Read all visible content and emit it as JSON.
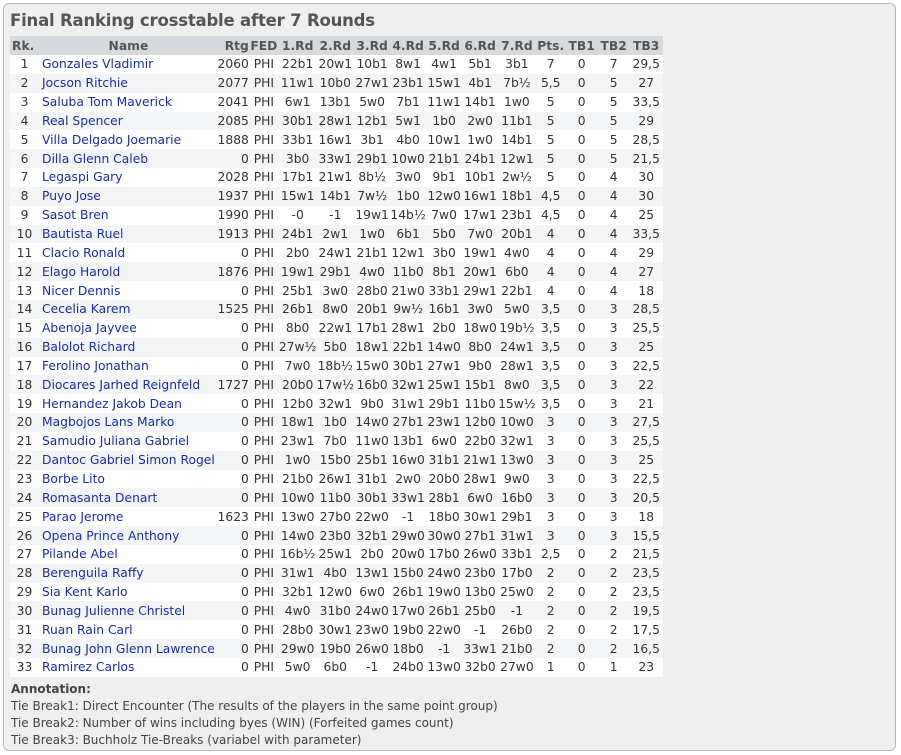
{
  "title": "Final Ranking crosstable after 7 Rounds",
  "columns": [
    "Rk.",
    "Name",
    "Rtg",
    "FED",
    "1.Rd",
    "2.Rd",
    "3.Rd",
    "4.Rd",
    "5.Rd",
    "6.Rd",
    "7.Rd",
    "Pts.",
    "TB1",
    "TB2",
    "TB3"
  ],
  "rows": [
    [
      "1",
      "Gonzales Vladimir",
      "2060",
      "PHI",
      "22b1",
      "20w1",
      "10b1",
      "8w1",
      "4w1",
      "5b1",
      "3b1",
      "7",
      "0",
      "7",
      "29,5"
    ],
    [
      "2",
      "Jocson Ritchie",
      "2077",
      "PHI",
      "11w1",
      "10b0",
      "27w1",
      "23b1",
      "15w1",
      "4b1",
      "7b½",
      "5,5",
      "0",
      "5",
      "27"
    ],
    [
      "3",
      "Saluba Tom Maverick",
      "2041",
      "PHI",
      "6w1",
      "13b1",
      "5w0",
      "7b1",
      "11w1",
      "14b1",
      "1w0",
      "5",
      "0",
      "5",
      "33,5"
    ],
    [
      "4",
      "Real Spencer",
      "2085",
      "PHI",
      "30b1",
      "28w1",
      "12b1",
      "5w1",
      "1b0",
      "2w0",
      "11b1",
      "5",
      "0",
      "5",
      "29"
    ],
    [
      "5",
      "Villa Delgado Joemarie",
      "1888",
      "PHI",
      "33b1",
      "16w1",
      "3b1",
      "4b0",
      "10w1",
      "1w0",
      "14b1",
      "5",
      "0",
      "5",
      "28,5"
    ],
    [
      "6",
      "Dilla Glenn Caleb",
      "0",
      "PHI",
      "3b0",
      "33w1",
      "29b1",
      "10w0",
      "21b1",
      "24b1",
      "12w1",
      "5",
      "0",
      "5",
      "21,5"
    ],
    [
      "7",
      "Legaspi Gary",
      "2028",
      "PHI",
      "17b1",
      "21w1",
      "8b½",
      "3w0",
      "9b1",
      "10b1",
      "2w½",
      "5",
      "0",
      "4",
      "30"
    ],
    [
      "8",
      "Puyo Jose",
      "1937",
      "PHI",
      "15w1",
      "14b1",
      "7w½",
      "1b0",
      "12w0",
      "16w1",
      "18b1",
      "4,5",
      "0",
      "4",
      "30"
    ],
    [
      "9",
      "Sasot Bren",
      "1990",
      "PHI",
      "-0",
      "-1",
      "19w1",
      "14b½",
      "7w0",
      "17w1",
      "23b1",
      "4,5",
      "0",
      "4",
      "25"
    ],
    [
      "10",
      "Bautista Ruel",
      "1913",
      "PHI",
      "24b1",
      "2w1",
      "1w0",
      "6b1",
      "5b0",
      "7w0",
      "20b1",
      "4",
      "0",
      "4",
      "33,5"
    ],
    [
      "11",
      "Clacio Ronald",
      "0",
      "PHI",
      "2b0",
      "24w1",
      "21b1",
      "12w1",
      "3b0",
      "19w1",
      "4w0",
      "4",
      "0",
      "4",
      "29"
    ],
    [
      "12",
      "Elago Harold",
      "1876",
      "PHI",
      "19w1",
      "29b1",
      "4w0",
      "11b0",
      "8b1",
      "20w1",
      "6b0",
      "4",
      "0",
      "4",
      "27"
    ],
    [
      "13",
      "Nicer Dennis",
      "0",
      "PHI",
      "25b1",
      "3w0",
      "28b0",
      "21w0",
      "33b1",
      "29w1",
      "22b1",
      "4",
      "0",
      "4",
      "18"
    ],
    [
      "14",
      "Cecelia Karem",
      "1525",
      "PHI",
      "26b1",
      "8w0",
      "20b1",
      "9w½",
      "16b1",
      "3w0",
      "5w0",
      "3,5",
      "0",
      "3",
      "28,5"
    ],
    [
      "15",
      "Abenoja Jayvee",
      "0",
      "PHI",
      "8b0",
      "22w1",
      "17b1",
      "28w1",
      "2b0",
      "18w0",
      "19b½",
      "3,5",
      "0",
      "3",
      "25,5"
    ],
    [
      "16",
      "Balolot Richard",
      "0",
      "PHI",
      "27w½",
      "5b0",
      "18w1",
      "22b1",
      "14w0",
      "8b0",
      "24w1",
      "3,5",
      "0",
      "3",
      "25"
    ],
    [
      "17",
      "Ferolino Jonathan",
      "0",
      "PHI",
      "7w0",
      "18b½",
      "15w0",
      "30b1",
      "27w1",
      "9b0",
      "28w1",
      "3,5",
      "0",
      "3",
      "22,5"
    ],
    [
      "18",
      "Diocares Jarhed Reignfeld",
      "1727",
      "PHI",
      "20b0",
      "17w½",
      "16b0",
      "32w1",
      "25w1",
      "15b1",
      "8w0",
      "3,5",
      "0",
      "3",
      "22"
    ],
    [
      "19",
      "Hernandez Jakob Dean",
      "0",
      "PHI",
      "12b0",
      "32w1",
      "9b0",
      "31w1",
      "29b1",
      "11b0",
      "15w½",
      "3,5",
      "0",
      "3",
      "21"
    ],
    [
      "20",
      "Magbojos Lans Marko",
      "0",
      "PHI",
      "18w1",
      "1b0",
      "14w0",
      "27b1",
      "23w1",
      "12b0",
      "10w0",
      "3",
      "0",
      "3",
      "27,5"
    ],
    [
      "21",
      "Samudio Juliana Gabriel",
      "0",
      "PHI",
      "23w1",
      "7b0",
      "11w0",
      "13b1",
      "6w0",
      "22b0",
      "32w1",
      "3",
      "0",
      "3",
      "25,5"
    ],
    [
      "22",
      "Dantoc Gabriel Simon Rogel",
      "0",
      "PHI",
      "1w0",
      "15b0",
      "25b1",
      "16w0",
      "31b1",
      "21w1",
      "13w0",
      "3",
      "0",
      "3",
      "25"
    ],
    [
      "23",
      "Borbe Lito",
      "0",
      "PHI",
      "21b0",
      "26w1",
      "31b1",
      "2w0",
      "20b0",
      "28w1",
      "9w0",
      "3",
      "0",
      "3",
      "22,5"
    ],
    [
      "24",
      "Romasanta Denart",
      "0",
      "PHI",
      "10w0",
      "11b0",
      "30b1",
      "33w1",
      "28b1",
      "6w0",
      "16b0",
      "3",
      "0",
      "3",
      "20,5"
    ],
    [
      "25",
      "Parao Jerome",
      "1623",
      "PHI",
      "13w0",
      "27b0",
      "22w0",
      "-1",
      "18b0",
      "30w1",
      "29b1",
      "3",
      "0",
      "3",
      "18"
    ],
    [
      "26",
      "Opena Prince Anthony",
      "0",
      "PHI",
      "14w0",
      "23b0",
      "32b1",
      "29w0",
      "30w0",
      "27b1",
      "31w1",
      "3",
      "0",
      "3",
      "15,5"
    ],
    [
      "27",
      "Pilande Abel",
      "0",
      "PHI",
      "16b½",
      "25w1",
      "2b0",
      "20w0",
      "17b0",
      "26w0",
      "33b1",
      "2,5",
      "0",
      "2",
      "21,5"
    ],
    [
      "28",
      "Berenguila Raffy",
      "0",
      "PHI",
      "31w1",
      "4b0",
      "13w1",
      "15b0",
      "24w0",
      "23b0",
      "17b0",
      "2",
      "0",
      "2",
      "23,5"
    ],
    [
      "29",
      "Sia Kent Karlo",
      "0",
      "PHI",
      "32b1",
      "12w0",
      "6w0",
      "26b1",
      "19w0",
      "13b0",
      "25w0",
      "2",
      "0",
      "2",
      "23,5"
    ],
    [
      "30",
      "Bunag Julienne Christel",
      "0",
      "PHI",
      "4w0",
      "31b0",
      "24w0",
      "17w0",
      "26b1",
      "25b0",
      "-1",
      "2",
      "0",
      "2",
      "19,5"
    ],
    [
      "31",
      "Ruan Rain Carl",
      "0",
      "PHI",
      "28b0",
      "30w1",
      "23w0",
      "19b0",
      "22w0",
      "-1",
      "26b0",
      "2",
      "0",
      "2",
      "17,5"
    ],
    [
      "32",
      "Bunag John Glenn Lawrence",
      "0",
      "PHI",
      "29w0",
      "19b0",
      "26w0",
      "18b0",
      "-1",
      "33w1",
      "21b0",
      "2",
      "0",
      "2",
      "16,5"
    ],
    [
      "33",
      "Ramirez Carlos",
      "0",
      "PHI",
      "5w0",
      "6b0",
      "-1",
      "24b0",
      "13w0",
      "32b0",
      "27w0",
      "1",
      "0",
      "1",
      "23"
    ]
  ],
  "annotation": {
    "heading": "Annotation:",
    "lines": [
      "Tie Break1: Direct Encounter (The results of the players in the same point group)",
      "Tie Break2: Number of wins including byes (WIN) (Forfeited games count)",
      "Tie Break3: Buchholz Tie-Breaks (variabel with parameter)"
    ]
  }
}
